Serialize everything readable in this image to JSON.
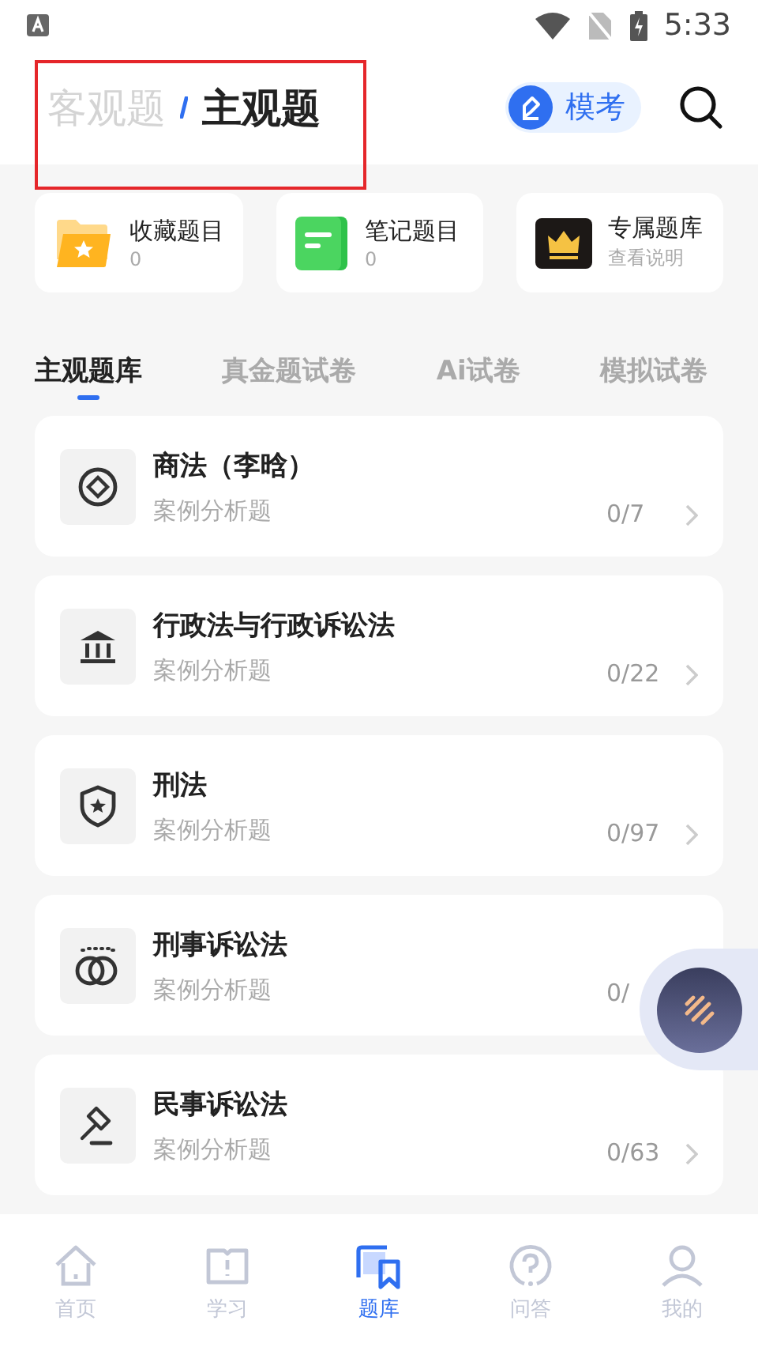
{
  "status_bar": {
    "time": "5:33"
  },
  "header": {
    "segments": [
      {
        "label": "客观题",
        "selected": false
      },
      {
        "label": "主观题",
        "selected": true
      }
    ],
    "exam_button": "模考"
  },
  "shortcuts": [
    {
      "kind": "star",
      "title": "收藏题目",
      "subtitle": "0"
    },
    {
      "kind": "note",
      "title": "笔记题目",
      "subtitle": "0"
    },
    {
      "kind": "crown",
      "title": "专属题库",
      "subtitle": "查看说明"
    }
  ],
  "tabs": [
    {
      "label": "主观题库",
      "selected": true
    },
    {
      "label": "真金题试卷",
      "selected": false
    },
    {
      "label": "Ai试卷",
      "selected": false
    },
    {
      "label": "模拟试卷",
      "selected": false
    }
  ],
  "subjects": [
    {
      "kind": "coin",
      "title": "商法（李晗）",
      "type": "案例分析题",
      "count": "0/7",
      "arrow": true
    },
    {
      "kind": "bank",
      "title": "行政法与行政诉讼法",
      "type": "案例分析题",
      "count": "0/22",
      "arrow": true
    },
    {
      "kind": "shield",
      "title": "刑法",
      "type": "案例分析题",
      "count": "0/97",
      "arrow": true
    },
    {
      "kind": "handcuffs",
      "title": "刑事诉讼法",
      "type": "案例分析题",
      "count": "0/",
      "arrow": false
    },
    {
      "kind": "gavel",
      "title": "民事诉讼法",
      "type": "案例分析题",
      "count": "0/63",
      "arrow": true
    }
  ],
  "bottom_nav": [
    {
      "kind": "home",
      "label": "首页",
      "selected": false
    },
    {
      "kind": "book",
      "label": "学习",
      "selected": false
    },
    {
      "kind": "bank",
      "label": "题库",
      "selected": true
    },
    {
      "kind": "qa",
      "label": "问答",
      "selected": false
    },
    {
      "kind": "me",
      "label": "我的",
      "selected": false
    }
  ]
}
